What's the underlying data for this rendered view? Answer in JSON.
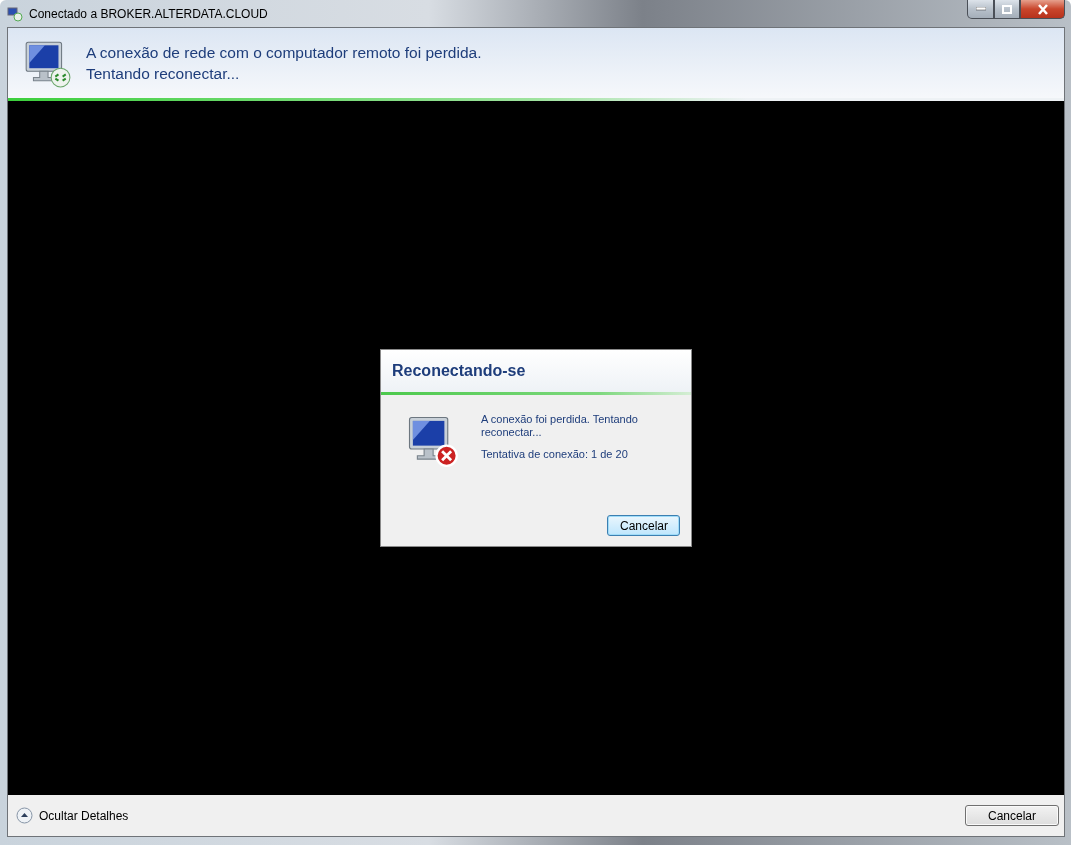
{
  "window": {
    "title": "Conectado a BROKER.ALTERDATA.CLOUD"
  },
  "header": {
    "lines": [
      "A conexão de rede com o computador remoto foi perdida.",
      "Tentando reconectar..."
    ]
  },
  "dialog": {
    "title": "Reconectando-se",
    "message": "A conexão foi perdida. Tentando reconectar...",
    "attempt": "Tentativa de conexão: 1 de 20",
    "button": "Cancelar"
  },
  "footer": {
    "toggle": "Ocultar Detalhes",
    "button": "Cancelar"
  }
}
